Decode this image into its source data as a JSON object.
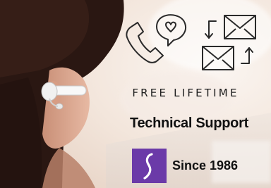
{
  "promo": {
    "headline": "FREE LIFETIME",
    "subheadline": "Technical Support",
    "since": "Since 1986"
  },
  "icons": {
    "phone": "phone-icon",
    "speech_bubble_heart": "heart-speech-bubble-icon",
    "envelope_top": "envelope-icon",
    "envelope_bottom": "envelope-icon",
    "arrows": "exchange-arrows-icon",
    "logo": "brand-logo-icon"
  },
  "colors": {
    "logo_background": "#6b3aa8",
    "text": "#111111"
  }
}
